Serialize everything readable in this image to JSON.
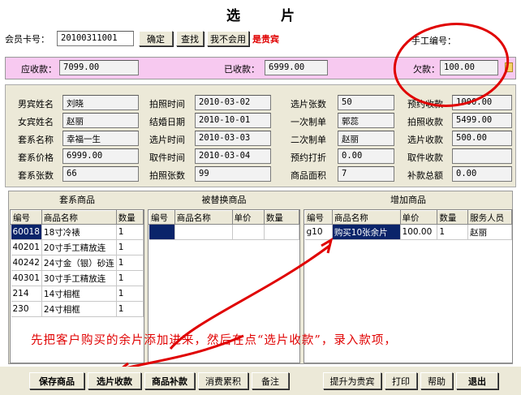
{
  "title": "选片",
  "member": {
    "label": "会员卡号：",
    "card_no": "20100311001",
    "confirm": "确定",
    "search": "查找",
    "no_card": "我不会用",
    "is_vip": "是贵宾"
  },
  "staff": {
    "label": "手工编号："
  },
  "payment": {
    "receivable_label": "应收款：",
    "receivable": "7099.00",
    "received_label": "已收款：",
    "received": "6999.00",
    "owed_label": "欠款：",
    "owed": "100.00"
  },
  "info": {
    "col1": [
      {
        "label": "男宾姓名",
        "value": "刘晓"
      },
      {
        "label": "女宾姓名",
        "value": "赵丽"
      },
      {
        "label": "套系名称",
        "value": "幸福一生"
      },
      {
        "label": "套系价格",
        "value": "6999.00"
      },
      {
        "label": "套系张数",
        "value": "66"
      }
    ],
    "col2": [
      {
        "label": "拍照时间",
        "value": "2010-03-02"
      },
      {
        "label": "结婚日期",
        "value": "2010-10-01"
      },
      {
        "label": "选片时间",
        "value": "2010-03-03"
      },
      {
        "label": "取件时间",
        "value": "2010-03-04"
      },
      {
        "label": "拍照张数",
        "value": "99"
      }
    ],
    "col3": [
      {
        "label": "选片张数",
        "value": "50"
      },
      {
        "label": "一次制单",
        "value": "郭蕊"
      },
      {
        "label": "二次制单",
        "value": "赵丽"
      },
      {
        "label": "预约打折",
        "value": "0.00"
      },
      {
        "label": "商品面积",
        "value": "7"
      }
    ],
    "col4": [
      {
        "label": "预约收款",
        "value": "1000.00"
      },
      {
        "label": "拍照收款",
        "value": "5499.00"
      },
      {
        "label": "选片收款",
        "value": "500.00"
      },
      {
        "label": "取件收款",
        "value": ""
      },
      {
        "label": "补款总额",
        "value": "0.00"
      }
    ]
  },
  "package_goods": {
    "title": "套系商品",
    "columns": [
      "编号",
      "商品名称",
      "数量"
    ],
    "rows": [
      [
        "60018",
        "18寸冷裱",
        "1"
      ],
      [
        "40201",
        "20寸手工精放连",
        "1"
      ],
      [
        "40242",
        "24寸金（银）砂连",
        "1"
      ],
      [
        "40301",
        "30寸手工精放连",
        "1"
      ],
      [
        "214",
        "14寸相框",
        "1"
      ],
      [
        "230",
        "24寸相框",
        "1"
      ]
    ]
  },
  "replaced_goods": {
    "title": "被替换商品",
    "columns": [
      "编号",
      "商品名称",
      "单价",
      "数量"
    ]
  },
  "added_goods": {
    "title": "增加商品",
    "columns": [
      "编号",
      "商品名称",
      "单价",
      "数量",
      "服务人员"
    ],
    "rows": [
      [
        "g10",
        "购买10张余片",
        "100.00",
        "1",
        "赵丽"
      ]
    ]
  },
  "annotation": "先把客户购买的余片添加进来，然后在点“选片收款”，录入款项，",
  "footer": {
    "save": "保存商品",
    "select_payment": "选片收款",
    "goods_payment": "商品补款",
    "points": "消费累积",
    "remark": "备注",
    "upgrade_vip": "提升为贵宾",
    "print": "打印",
    "help": "帮助",
    "exit": "退出"
  },
  "colors": {
    "accent_red": "#e00000",
    "pay_band": "#f7c9f0",
    "selection": "#0a246a",
    "window_bg": "#ece9d8"
  }
}
